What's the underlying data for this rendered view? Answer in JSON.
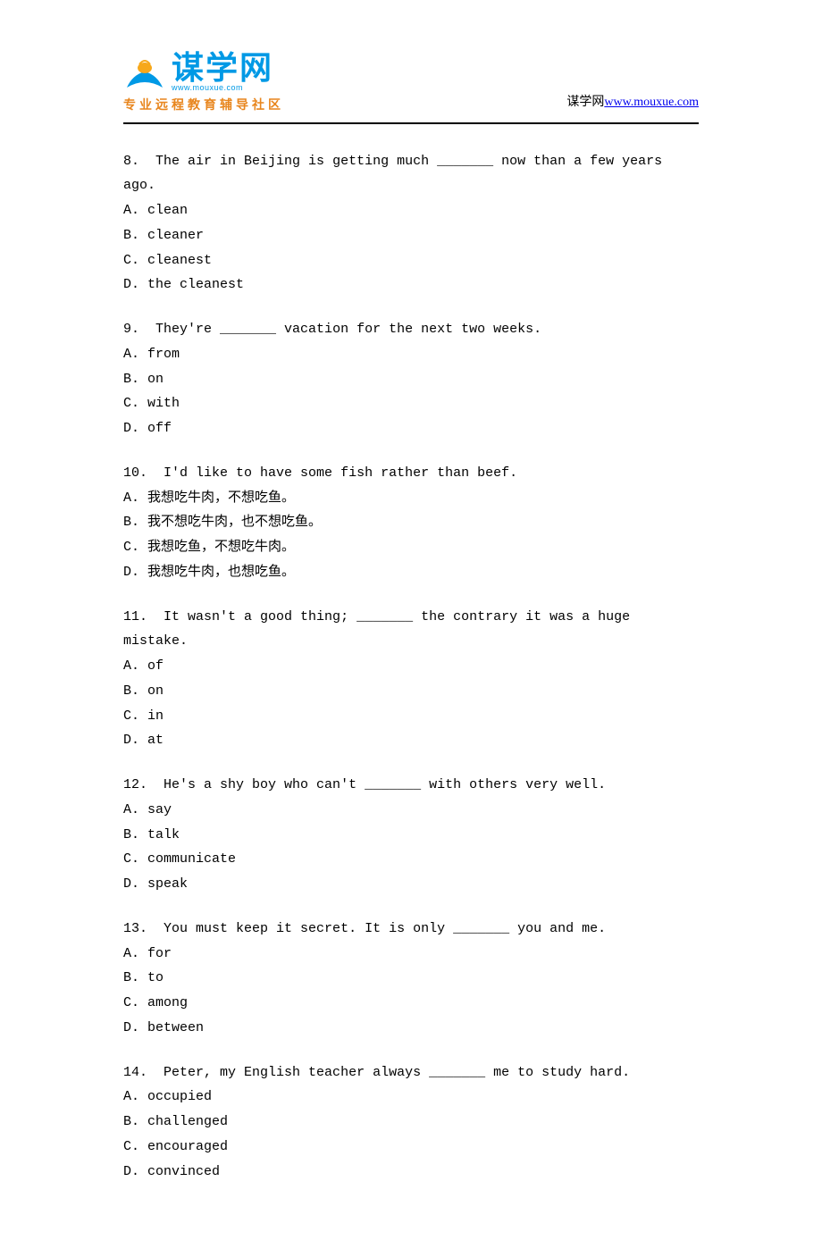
{
  "header": {
    "logo_chinese": "谋学网",
    "logo_pinyin": "www.mouxue.com",
    "logo_tagline": "专业远程教育辅导社区",
    "site_label": "谋学网",
    "site_url_text": "www.mouxue.com"
  },
  "questions": [
    {
      "num": "8.",
      "stem": "The air in Beijing is getting much _______ now than a few years ago.",
      "options": [
        "A. clean",
        "B. cleaner",
        "C. cleanest",
        "D. the cleanest"
      ]
    },
    {
      "num": "9.",
      "stem": "They're _______ vacation for the next two weeks.",
      "options": [
        "A. from",
        "B. on",
        "C. with",
        "D. off"
      ]
    },
    {
      "num": "10.",
      "stem": "I'd like to have some fish rather than beef.",
      "options": [
        "A. 我想吃牛肉，不想吃鱼。",
        "B. 我不想吃牛肉，也不想吃鱼。",
        "C. 我想吃鱼，不想吃牛肉。",
        "D. 我想吃牛肉，也想吃鱼。"
      ]
    },
    {
      "num": "11.",
      "stem": "It wasn't a good thing; _______ the contrary it was a huge mistake.",
      "options": [
        "A. of",
        "B. on",
        "C. in",
        "D. at"
      ]
    },
    {
      "num": "12.",
      "stem": "He's a shy boy who can't _______ with others very well.",
      "options": [
        "A. say",
        "B. talk",
        "C. communicate",
        "D. speak"
      ]
    },
    {
      "num": "13.",
      "stem": "You must keep it secret. It is only _______ you and me.",
      "options": [
        "A. for",
        "B. to",
        "C. among",
        "D. between"
      ]
    },
    {
      "num": "14.",
      "stem": "Peter, my English teacher always _______ me to study hard.",
      "options": [
        "A. occupied",
        "B. challenged",
        "C. encouraged",
        "D. convinced"
      ]
    }
  ]
}
